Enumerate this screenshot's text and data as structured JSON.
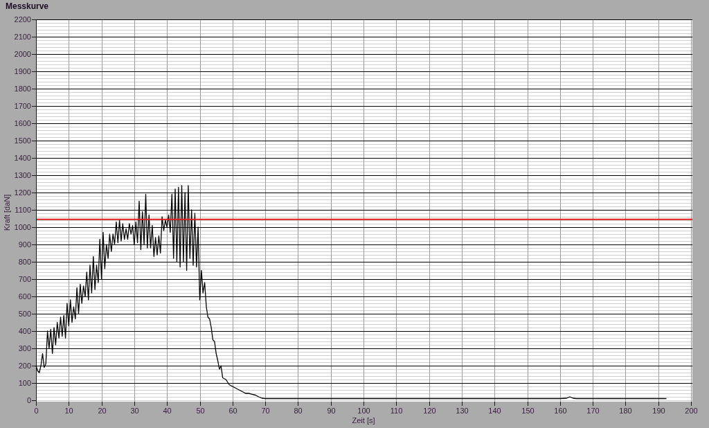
{
  "panel": {
    "chart_data": {
      "type": "line",
      "title": "Messkurve",
      "xlabel": "Zeit [s]",
      "ylabel": "Kraft [daN]",
      "grid": true,
      "x": [
        0,
        0.5,
        1,
        1.5,
        2,
        2.5,
        3,
        3.5,
        4,
        4.5,
        5,
        5.5,
        6,
        6.5,
        7,
        7.5,
        8,
        8.5,
        9,
        9.5,
        10,
        10.5,
        11,
        11.5,
        12,
        12.5,
        13,
        13.5,
        14,
        14.5,
        15,
        15.5,
        16,
        16.5,
        17,
        17.5,
        18,
        18.5,
        19,
        19.5,
        20,
        20.5,
        21,
        21.5,
        22,
        22.5,
        23,
        23.5,
        24,
        24.5,
        25,
        25.5,
        26,
        26.5,
        27,
        27.5,
        28,
        28.5,
        29,
        29.5,
        30,
        30.5,
        31,
        31.5,
        32,
        32.5,
        33,
        33.5,
        34,
        34.5,
        35,
        35.5,
        36,
        36.5,
        37,
        37.5,
        38,
        38.5,
        39,
        39.5,
        40,
        40.5,
        41,
        41.5,
        42,
        42.5,
        43,
        43.5,
        44,
        44.5,
        45,
        45.5,
        46,
        46.5,
        47,
        47.5,
        48,
        48.5,
        49,
        49.5,
        50,
        50.5,
        51,
        51.5,
        52,
        52.5,
        53,
        53.5,
        54,
        54.5,
        55,
        55.5,
        56,
        56.5,
        57,
        58,
        59,
        60,
        61,
        62,
        63,
        64,
        65,
        66,
        67,
        68,
        69,
        70,
        75,
        80,
        85,
        90,
        95,
        100,
        105,
        110,
        115,
        120,
        125,
        130,
        135,
        140,
        145,
        150,
        155,
        160,
        162,
        163,
        164,
        165,
        170,
        175,
        180,
        185,
        190,
        192.5
      ],
      "series": [
        {
          "color": "#000000",
          "values": [
            200,
            170,
            160,
            200,
            270,
            190,
            210,
            400,
            300,
            410,
            270,
            420,
            320,
            450,
            360,
            480,
            370,
            490,
            360,
            560,
            430,
            580,
            450,
            540,
            470,
            650,
            500,
            670,
            560,
            660,
            600,
            740,
            580,
            780,
            620,
            830,
            640,
            780,
            680,
            930,
            700,
            970,
            760,
            900,
            820,
            960,
            860,
            960,
            900,
            1030,
            910,
            1040,
            920,
            1020,
            930,
            990,
            930,
            1020,
            960,
            1010,
            900,
            1030,
            910,
            1150,
            870,
            1090,
            900,
            1190,
            880,
            1070,
            880,
            1010,
            830,
            940,
            840,
            950,
            850,
            1060,
            980,
            1040,
            1000,
            1070,
            970,
            1190,
            820,
            1220,
            800,
            1230,
            770,
            1240,
            800,
            1200,
            750,
            1240,
            820,
            1100,
            780,
            1080,
            770,
            1000,
            580,
            750,
            620,
            680,
            540,
            480,
            470,
            420,
            350,
            340,
            270,
            230,
            180,
            200,
            130,
            120,
            90,
            80,
            70,
            60,
            50,
            40,
            40,
            35,
            30,
            20,
            12,
            10,
            10,
            10,
            10,
            10,
            10,
            10,
            10,
            10,
            10,
            10,
            10,
            10,
            10,
            10,
            10,
            10,
            10,
            10,
            12,
            20,
            12,
            10,
            10,
            10,
            10,
            10,
            10,
            10
          ]
        }
      ],
      "xlim": [
        0,
        200
      ],
      "ylim": [
        0,
        2200
      ],
      "xticks": [
        0,
        10,
        20,
        30,
        40,
        50,
        60,
        70,
        80,
        90,
        100,
        110,
        120,
        130,
        140,
        150,
        160,
        170,
        180,
        190,
        200
      ],
      "yticks": [
        0,
        100,
        200,
        300,
        400,
        500,
        600,
        700,
        800,
        900,
        1000,
        1100,
        1200,
        1300,
        1400,
        1500,
        1600,
        1700,
        1800,
        1900,
        2000,
        2100,
        2200
      ],
      "ref_lines": [
        {
          "axis": "y",
          "value": 1045,
          "color": "#e01818"
        }
      ]
    }
  }
}
